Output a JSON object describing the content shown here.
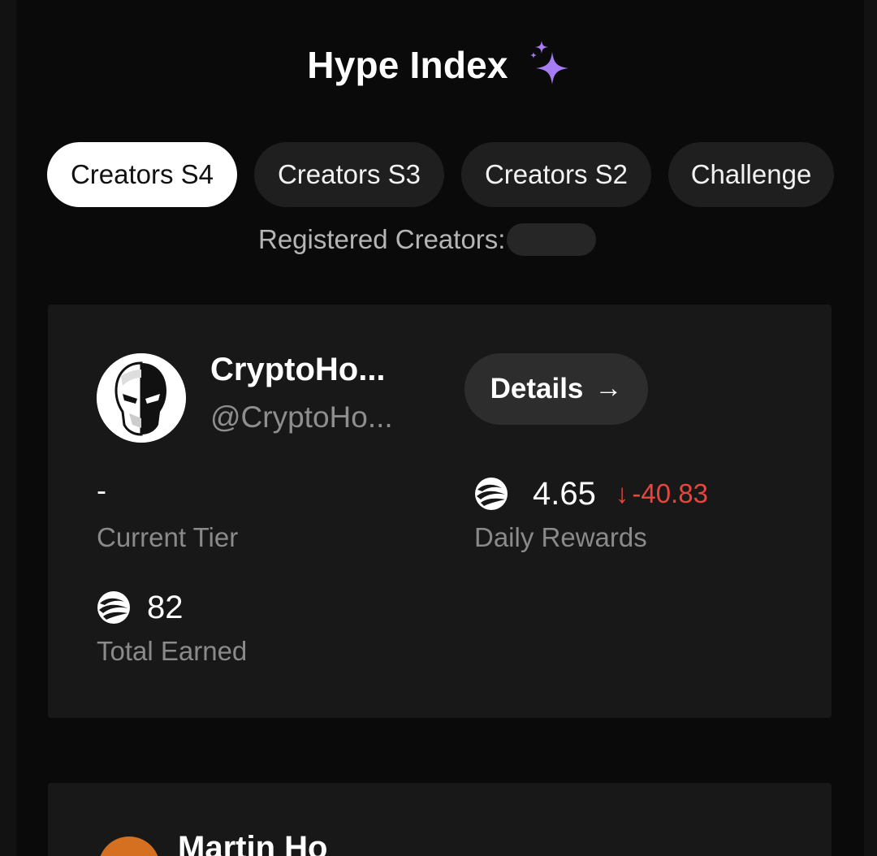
{
  "header": {
    "title": "Hype Index",
    "sparkle_icon": "sparkle-icon",
    "sparkle_color": "#a67cf5"
  },
  "tabs": [
    {
      "label": "Creators S4",
      "active": true
    },
    {
      "label": "Creators S3",
      "active": false
    },
    {
      "label": "Creators S2",
      "active": false
    },
    {
      "label": "Challenge",
      "active": false
    }
  ],
  "registered": {
    "label": "Registered Creators:",
    "value_redacted": true
  },
  "creator_card": {
    "name": "CryptoHo...",
    "handle": "@CryptoHo...",
    "details_label": "Details",
    "details_arrow": "→",
    "current_tier": {
      "value": "-",
      "label": "Current Tier"
    },
    "daily_rewards": {
      "value": "4.65",
      "change_arrow": "↓",
      "change": "-40.83",
      "change_color": "#e8453c",
      "label": "Daily Rewards"
    },
    "total_earned": {
      "value": "82",
      "label": "Total Earned"
    }
  },
  "next_card": {
    "name": "Martin Ho"
  }
}
